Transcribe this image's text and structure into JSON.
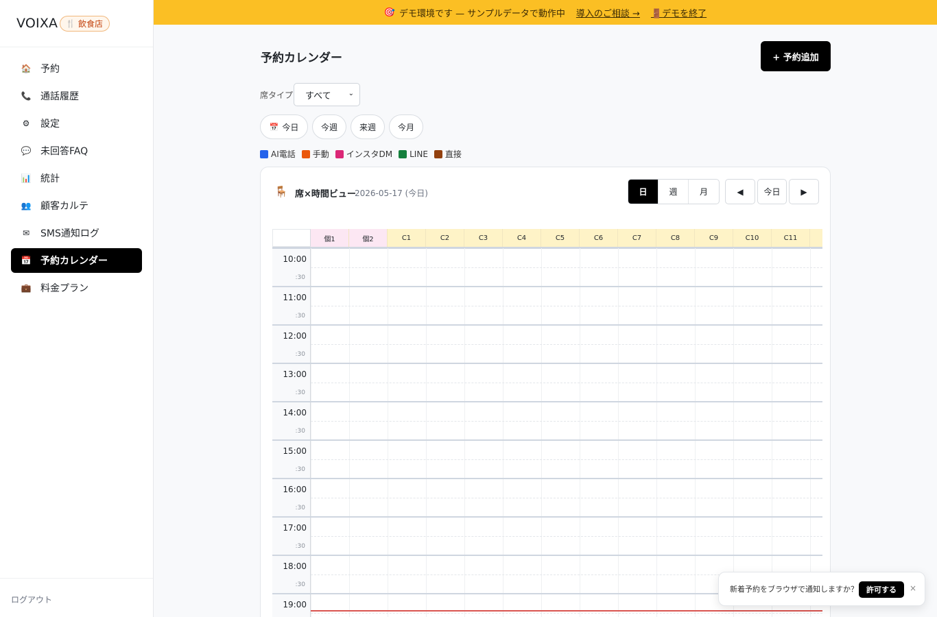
{
  "brand": {
    "name": "VOIXA",
    "badge": "飲食店",
    "badge_icon": "fork-knife-icon"
  },
  "sidebar": {
    "items": [
      {
        "label": "予約",
        "icon": "house-icon",
        "glyph": "🏠",
        "active": false
      },
      {
        "label": "通話履歴",
        "icon": "phone-icon",
        "glyph": "📞",
        "active": false
      },
      {
        "label": "設定",
        "icon": "gear-icon",
        "glyph": "⚙",
        "active": false
      },
      {
        "label": "未回答FAQ",
        "icon": "speech-bubble-icon",
        "glyph": "💬",
        "active": false
      },
      {
        "label": "統計",
        "icon": "bar-chart-icon",
        "glyph": "📊",
        "active": false
      },
      {
        "label": "顧客カルテ",
        "icon": "people-icon",
        "glyph": "👥",
        "active": false
      },
      {
        "label": "SMS通知ログ",
        "icon": "envelope-icon",
        "glyph": "✉",
        "active": false
      },
      {
        "label": "予約カレンダー",
        "icon": "calendar-icon",
        "glyph": "📅",
        "active": true
      },
      {
        "label": "料金プラン",
        "icon": "briefcase-icon",
        "glyph": "💼",
        "active": false
      }
    ],
    "logout": "ログアウト"
  },
  "banner": {
    "text": "デモ環境です — サンプルデータで動作中",
    "consult_link": "導入のご相談 →",
    "end_link": "デモを終了",
    "icon": "target-icon",
    "end_icon": "door-icon",
    "color": "#fbbf24"
  },
  "page": {
    "title": "予約カレンダー",
    "add_button": "+ 予約追加"
  },
  "filter": {
    "label": "席タイプ:",
    "selected": "すべて"
  },
  "quick_buttons": {
    "today": "今日",
    "this_week": "今週",
    "next_week": "来週",
    "this_month": "今月"
  },
  "legend": [
    {
      "label": "AI電話",
      "color": "#2563eb"
    },
    {
      "label": "手動",
      "color": "#ea580c"
    },
    {
      "label": "インスタDM",
      "color": "#db2777"
    },
    {
      "label": "LINE",
      "color": "#15803d"
    },
    {
      "label": "直接",
      "color": "#92400e"
    }
  ],
  "calendar": {
    "title": "席×時間ビュー",
    "date": "2026-05-17 (今日)",
    "view_tabs": {
      "day": "日",
      "week": "週",
      "month": "月",
      "active": "日"
    },
    "nav": {
      "prev": "◀",
      "today": "今日",
      "next": "▶"
    },
    "columns": [
      {
        "label": "個1",
        "kind": "private"
      },
      {
        "label": "個2",
        "kind": "private"
      },
      {
        "label": "C1",
        "kind": "counter"
      },
      {
        "label": "C2",
        "kind": "counter"
      },
      {
        "label": "C3",
        "kind": "counter"
      },
      {
        "label": "C4",
        "kind": "counter"
      },
      {
        "label": "C5",
        "kind": "counter"
      },
      {
        "label": "C6",
        "kind": "counter"
      },
      {
        "label": "C7",
        "kind": "counter"
      },
      {
        "label": "C8",
        "kind": "counter"
      },
      {
        "label": "C9",
        "kind": "counter"
      },
      {
        "label": "C10",
        "kind": "counter"
      },
      {
        "label": "C11",
        "kind": "counter"
      }
    ],
    "hours": [
      "10:00",
      "11:00",
      "12:00",
      "13:00",
      "14:00",
      "15:00",
      "16:00",
      "17:00",
      "18:00",
      "19:00"
    ],
    "half_label": ":30",
    "private_color": "#fce7f3",
    "counter_color": "#fef3c7"
  },
  "toast": {
    "text": "新着予約をブラウザで通知しますか？",
    "allow": "許可する",
    "close": "×"
  }
}
